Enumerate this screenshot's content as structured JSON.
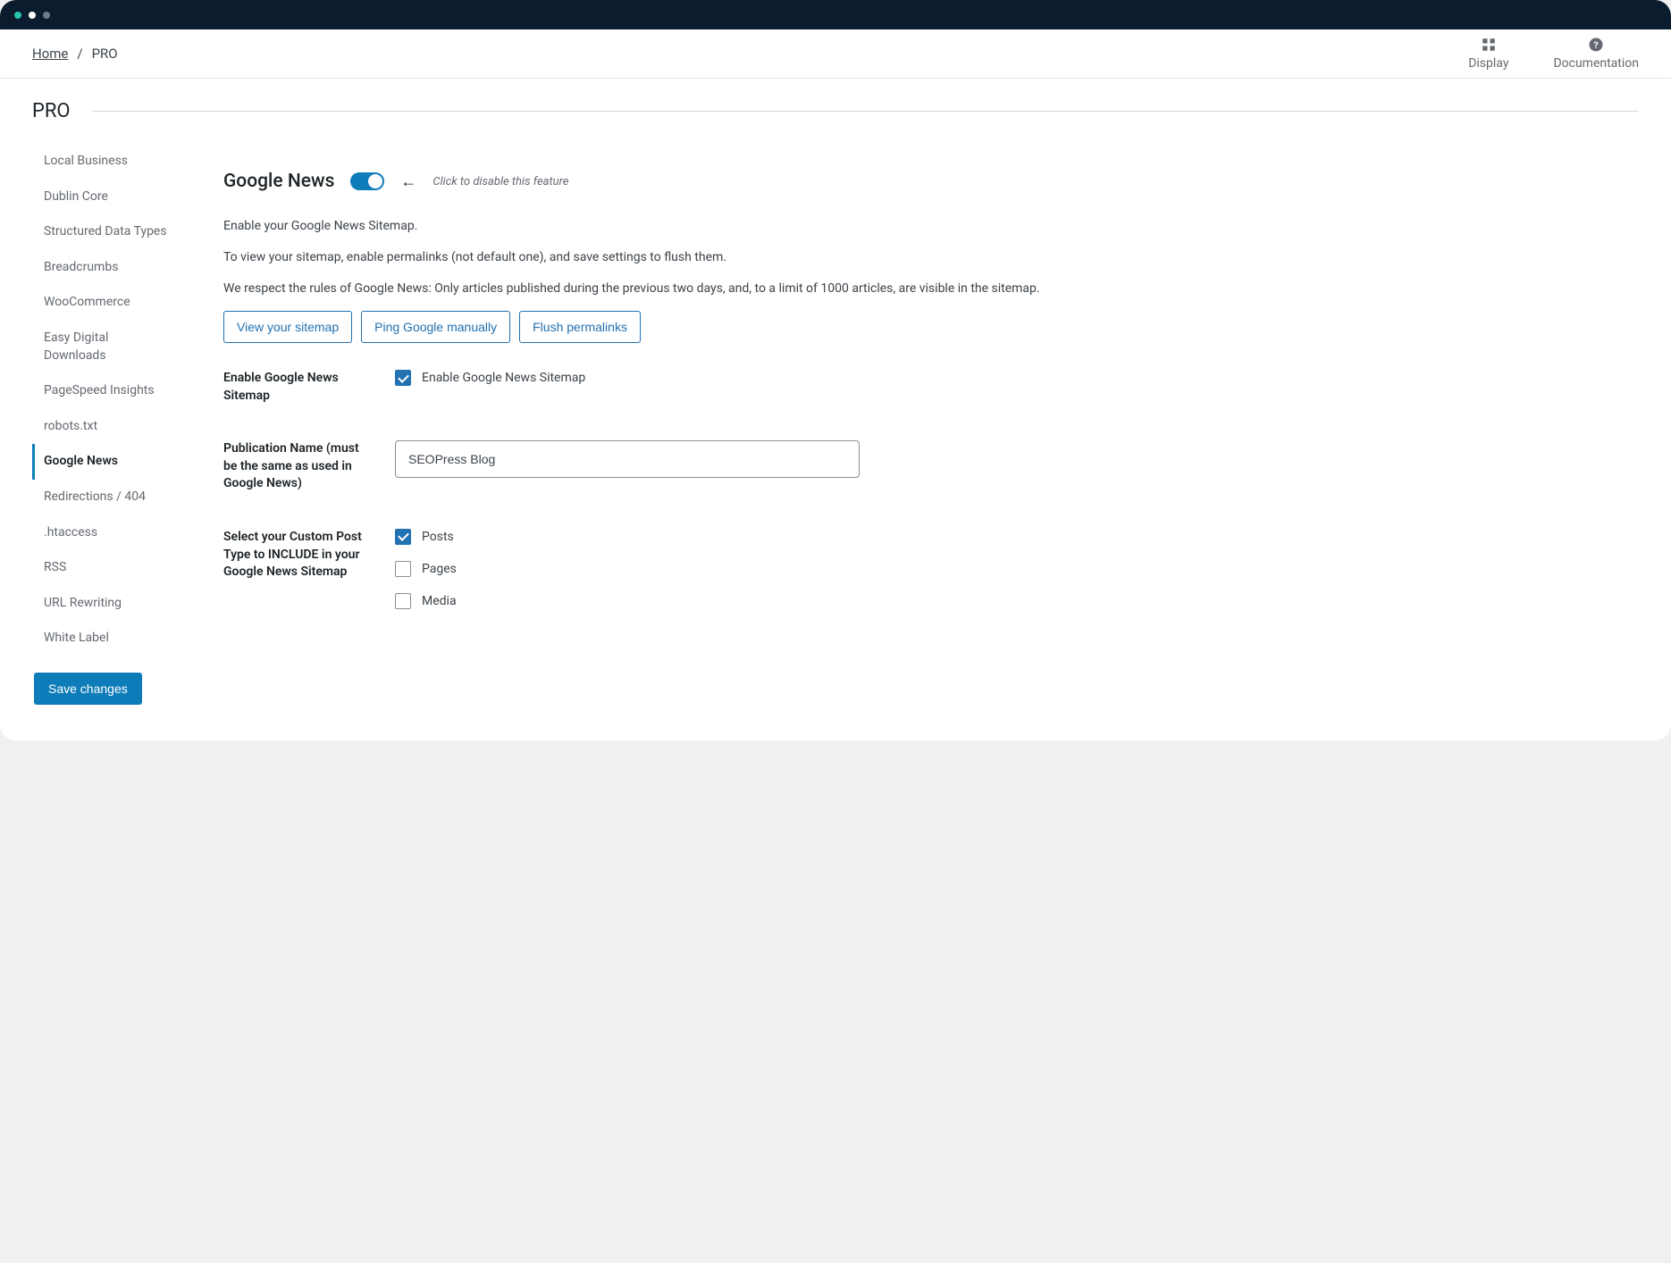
{
  "breadcrumb": {
    "home": "Home",
    "current": "PRO"
  },
  "top_actions": {
    "display": "Display",
    "documentation": "Documentation"
  },
  "page_title": "PRO",
  "sidebar": {
    "items": [
      {
        "label": "Local Business",
        "active": false
      },
      {
        "label": "Dublin Core",
        "active": false
      },
      {
        "label": "Structured Data Types",
        "active": false
      },
      {
        "label": "Breadcrumbs",
        "active": false
      },
      {
        "label": "WooCommerce",
        "active": false
      },
      {
        "label": "Easy Digital Downloads",
        "active": false
      },
      {
        "label": "PageSpeed Insights",
        "active": false
      },
      {
        "label": "robots.txt",
        "active": false
      },
      {
        "label": "Google News",
        "active": true
      },
      {
        "label": "Redirections / 404",
        "active": false
      },
      {
        "label": ".htaccess",
        "active": false
      },
      {
        "label": "RSS",
        "active": false
      },
      {
        "label": "URL Rewriting",
        "active": false
      },
      {
        "label": "White Label",
        "active": false
      }
    ],
    "save_label": "Save changes"
  },
  "section": {
    "title": "Google News",
    "toggle_on": true,
    "toggle_hint": "Click to disable this feature",
    "desc": [
      "Enable your Google News Sitemap.",
      "To view your sitemap, enable permalinks (not default one), and save settings to flush them.",
      "We respect the rules of Google News: Only articles published during the previous two days, and, to a limit of 1000 articles, are visible in the sitemap."
    ],
    "buttons": {
      "view": "View your sitemap",
      "ping": "Ping Google manually",
      "flush": "Flush permalinks"
    }
  },
  "form": {
    "enable_label": "Enable Google News Sitemap",
    "enable_checkbox_label": "Enable Google News Sitemap",
    "enable_checked": true,
    "publication_label": "Publication Name (must be the same as used in Google News)",
    "publication_value": "SEOPress Blog",
    "cpt_label": "Select your Custom Post Type to INCLUDE in your Google News Sitemap",
    "cpt_options": [
      {
        "label": "Posts",
        "checked": true
      },
      {
        "label": "Pages",
        "checked": false
      },
      {
        "label": "Media",
        "checked": false
      }
    ]
  },
  "colors": {
    "accent": "#0f7cba",
    "link": "#2271b1"
  }
}
